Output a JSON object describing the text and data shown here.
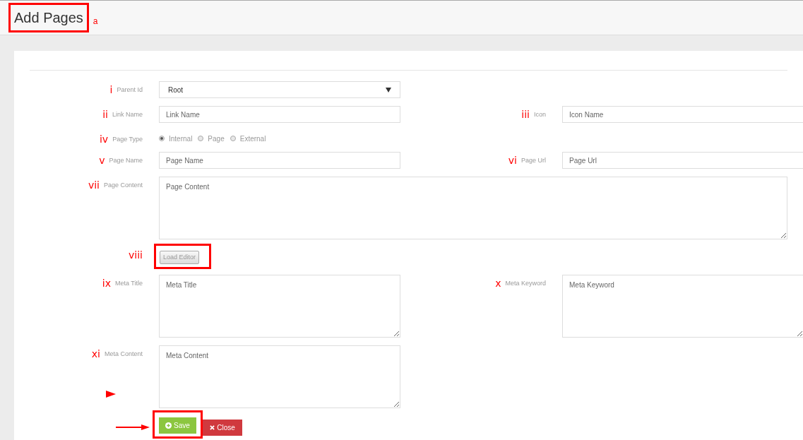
{
  "header": {
    "title": "Add Pages",
    "highlighted": true,
    "marker": "a"
  },
  "rows": [
    {
      "fields": [
        {
          "kind": "select",
          "marker": "i",
          "label": "Parent Id",
          "value": "Root"
        }
      ]
    },
    {
      "fields": [
        {
          "kind": "text",
          "marker": "ii",
          "label": "Link Name",
          "placeholder": "Link Name"
        },
        {
          "kind": "text",
          "marker": "iii",
          "label": "Icon",
          "placeholder": "Icon Name"
        }
      ]
    },
    {
      "fields": [
        {
          "kind": "radio",
          "marker": "iv",
          "label": "Page Type",
          "options": [
            {
              "label": "Internal",
              "selected": true
            },
            {
              "label": "Page",
              "selected": false
            },
            {
              "label": "External",
              "selected": false
            }
          ]
        }
      ]
    },
    {
      "fields": [
        {
          "kind": "text",
          "marker": "v",
          "label": "Page Name",
          "placeholder": "Page Name"
        },
        {
          "kind": "text",
          "marker": "vi",
          "label": "Page Url",
          "placeholder": "Page Url"
        }
      ]
    },
    {
      "fields": [
        {
          "kind": "wide_textarea",
          "marker": "vii",
          "label": "Page Content",
          "placeholder": "Page Content"
        }
      ]
    },
    {
      "fields": [
        {
          "kind": "button",
          "marker": "viii",
          "label": "Load Editor",
          "highlighted": true
        }
      ]
    },
    {
      "fields": [
        {
          "kind": "textarea",
          "marker": "ix",
          "label": "Meta Title",
          "placeholder": "Meta Title"
        },
        {
          "kind": "textarea",
          "marker": "x",
          "label": "Meta Keyword",
          "placeholder": "Meta Keyword"
        }
      ]
    },
    {
      "fields": [
        {
          "kind": "textarea",
          "marker": "xi",
          "label": "Meta Content",
          "placeholder": "Meta Content",
          "pointer": true
        }
      ]
    }
  ],
  "actions": [
    {
      "kind": "save",
      "label": "Save",
      "highlighted": true,
      "pointer": true
    },
    {
      "kind": "close",
      "label": "Close",
      "highlighted": false
    }
  ]
}
